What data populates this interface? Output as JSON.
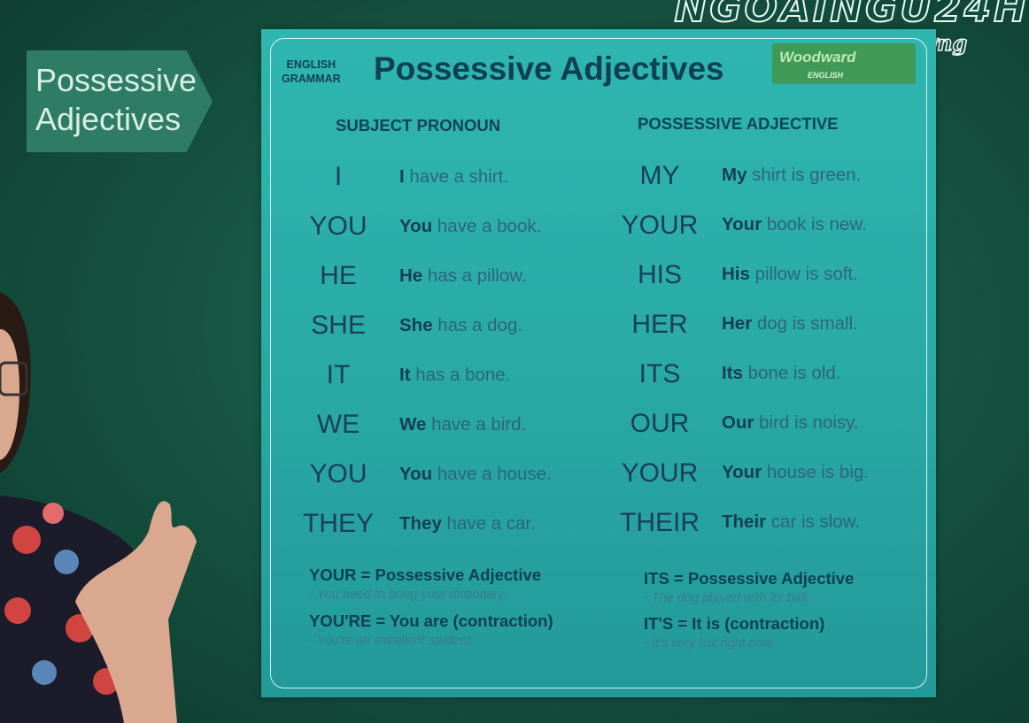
{
  "side_tag": {
    "line1": "Possessive",
    "line2": "Adjectives"
  },
  "brand": {
    "top": "NGOAINGU24H",
    "name": "Vũ Mai Phương"
  },
  "poster": {
    "eyebrow_line1": "ENGLISH",
    "eyebrow_line2": "GRAMMAR",
    "title": "Possessive Adjectives",
    "logo_text": "Woodward",
    "logo_sub": "ENGLISH",
    "col_subject": "SUBJECT PRONOUN",
    "col_possessive": "POSSESSIVE ADJECTIVE",
    "rows": [
      {
        "pronoun": "I",
        "s_bold": "I",
        "s_rest": " have a shirt.",
        "possessive": "MY",
        "p_bold": "My",
        "p_rest": " shirt is green."
      },
      {
        "pronoun": "YOU",
        "s_bold": "You",
        "s_rest": " have a book.",
        "possessive": "YOUR",
        "p_bold": "Your",
        "p_rest": " book is new."
      },
      {
        "pronoun": "HE",
        "s_bold": "He",
        "s_rest": " has a pillow.",
        "possessive": "HIS",
        "p_bold": "His",
        "p_rest": " pillow is soft."
      },
      {
        "pronoun": "SHE",
        "s_bold": "She",
        "s_rest": " has a dog.",
        "possessive": "HER",
        "p_bold": "Her",
        "p_rest": " dog is small."
      },
      {
        "pronoun": "IT",
        "s_bold": "It",
        "s_rest": " has a bone.",
        "possessive": "ITS",
        "p_bold": "Its",
        "p_rest": " bone is old."
      },
      {
        "pronoun": "WE",
        "s_bold": "We",
        "s_rest": " have a bird.",
        "possessive": "OUR",
        "p_bold": "Our",
        "p_rest": " bird is noisy."
      },
      {
        "pronoun": "YOU",
        "s_bold": "You",
        "s_rest": " have a house.",
        "possessive": "YOUR",
        "p_bold": "Your",
        "p_rest": " house is big."
      },
      {
        "pronoun": "THEY",
        "s_bold": "They",
        "s_rest": " have a car.",
        "possessive": "THEIR",
        "p_bold": "Their",
        "p_rest": " car is slow."
      }
    ],
    "notes": {
      "your_rule": "YOUR = Possessive Adjective",
      "your_example": "- You need to bring your dictionary.",
      "youre_rule": "YOU'RE = You are (contraction)",
      "youre_example": "- You're an excellent student.",
      "its_rule": "ITS = Possessive Adjective",
      "its_example": "- The dog played with its ball.",
      "itis_rule": "IT'S = It is (contraction)",
      "itis_example": "- It's very hot right now."
    }
  }
}
